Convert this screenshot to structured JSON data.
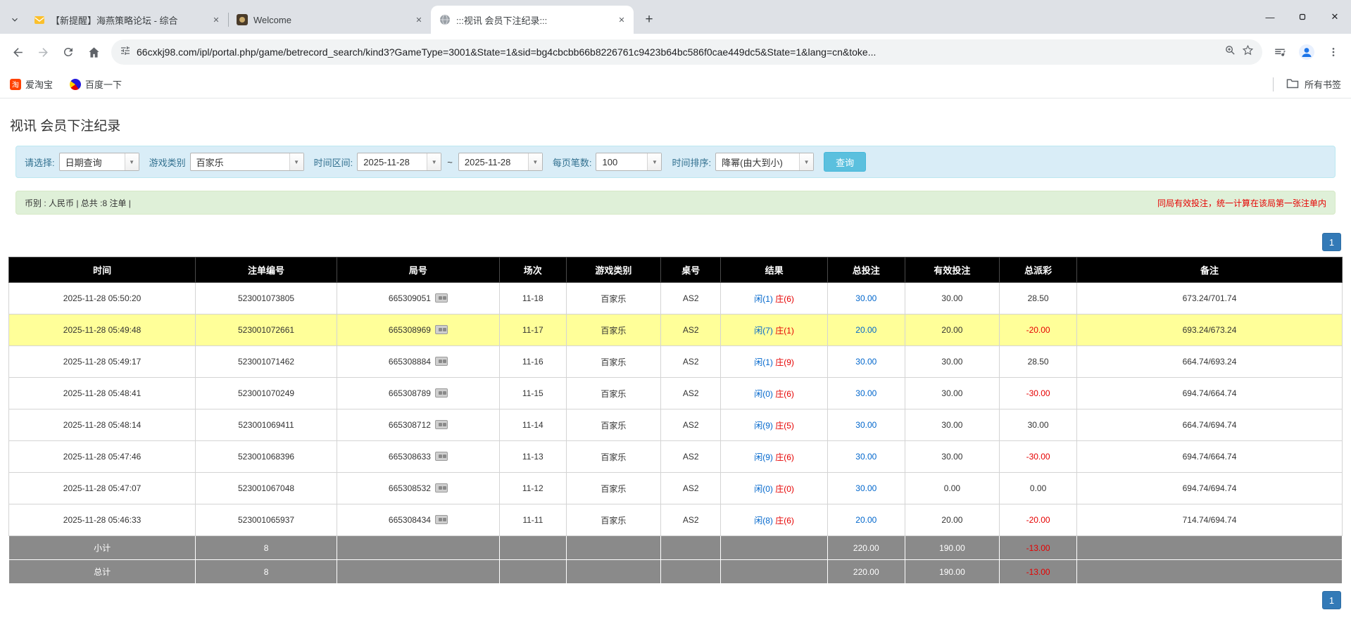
{
  "colors": {
    "accent_blue": "#337ab7",
    "link_blue": "#0066cc",
    "negative_red": "#e60000",
    "highlight_yellow": "#ffff99",
    "header_black": "#000000",
    "footer_gray": "#8a8a8a",
    "filter_bg": "#d9edf7",
    "summary_bg": "#dff0d8",
    "search_btn": "#5bc0de"
  },
  "browser": {
    "tabs": [
      {
        "title": "【新提醒】海燕策略论坛 - 综合"
      },
      {
        "title": "Welcome"
      },
      {
        "title": ":::视讯 会员下注纪录:::"
      }
    ],
    "url": "66cxkj98.com/ipl/portal.php/game/betrecord_search/kind3?GameType=3001&State=1&sid=bg4cbcbb66b8226761c9423b64bc586f0cae449dc5&State=1&lang=cn&toke...",
    "bookmarks": {
      "items": [
        {
          "label": "爱淘宝"
        },
        {
          "label": "百度一下"
        }
      ],
      "all_bookmarks": "所有书签"
    }
  },
  "page": {
    "title": "视讯 会员下注纪录",
    "filters": {
      "select_label": "请选择:",
      "select_value": "日期查询",
      "game_type_label": "游戏类别",
      "game_type_value": "百家乐",
      "date_range_label": "时间区间:",
      "date_from": "2025-11-28",
      "tilde": "~",
      "date_to": "2025-11-28",
      "page_size_label": "每页笔数:",
      "page_size_value": "100",
      "sort_label": "时间排序:",
      "sort_value": "降幂(由大到小)",
      "search_button": "查询"
    },
    "summary": {
      "left": "币别 : 人民币 | 总共 :8 注单 |",
      "right": "同局有效投注，统一计算在该局第一张注单内"
    },
    "pagination": "1",
    "table": {
      "headers": [
        "时间",
        "注单编号",
        "局号",
        "场次",
        "游戏类别",
        "桌号",
        "结果",
        "总投注",
        "有效投注",
        "总派彩",
        "备注"
      ],
      "rows": [
        {
          "time": "2025-11-28 05:50:20",
          "bet_id": "523001073805",
          "round_id": "665309051",
          "session": "11-18",
          "game": "百家乐",
          "table_no": "AS2",
          "result_player": "闲(1)",
          "result_banker": "庄(6)",
          "total_bet": "30.00",
          "valid_bet": "30.00",
          "payout": "28.50",
          "note": "673.24/701.74",
          "highlighted": false
        },
        {
          "time": "2025-11-28 05:49:48",
          "bet_id": "523001072661",
          "round_id": "665308969",
          "session": "11-17",
          "game": "百家乐",
          "table_no": "AS2",
          "result_player": "闲(7)",
          "result_banker": "庄(1)",
          "total_bet": "20.00",
          "valid_bet": "20.00",
          "payout": "-20.00",
          "note": "693.24/673.24",
          "highlighted": true
        },
        {
          "time": "2025-11-28 05:49:17",
          "bet_id": "523001071462",
          "round_id": "665308884",
          "session": "11-16",
          "game": "百家乐",
          "table_no": "AS2",
          "result_player": "闲(1)",
          "result_banker": "庄(9)",
          "total_bet": "30.00",
          "valid_bet": "30.00",
          "payout": "28.50",
          "note": "664.74/693.24",
          "highlighted": false
        },
        {
          "time": "2025-11-28 05:48:41",
          "bet_id": "523001070249",
          "round_id": "665308789",
          "session": "11-15",
          "game": "百家乐",
          "table_no": "AS2",
          "result_player": "闲(0)",
          "result_banker": "庄(6)",
          "total_bet": "30.00",
          "valid_bet": "30.00",
          "payout": "-30.00",
          "note": "694.74/664.74",
          "highlighted": false
        },
        {
          "time": "2025-11-28 05:48:14",
          "bet_id": "523001069411",
          "round_id": "665308712",
          "session": "11-14",
          "game": "百家乐",
          "table_no": "AS2",
          "result_player": "闲(9)",
          "result_banker": "庄(5)",
          "total_bet": "30.00",
          "valid_bet": "30.00",
          "payout": "30.00",
          "note": "664.74/694.74",
          "highlighted": false
        },
        {
          "time": "2025-11-28 05:47:46",
          "bet_id": "523001068396",
          "round_id": "665308633",
          "session": "11-13",
          "game": "百家乐",
          "table_no": "AS2",
          "result_player": "闲(9)",
          "result_banker": "庄(6)",
          "total_bet": "30.00",
          "valid_bet": "30.00",
          "payout": "-30.00",
          "note": "694.74/664.74",
          "highlighted": false
        },
        {
          "time": "2025-11-28 05:47:07",
          "bet_id": "523001067048",
          "round_id": "665308532",
          "session": "11-12",
          "game": "百家乐",
          "table_no": "AS2",
          "result_player": "闲(0)",
          "result_banker": "庄(0)",
          "total_bet": "30.00",
          "valid_bet": "0.00",
          "payout": "0.00",
          "note": "694.74/694.74",
          "highlighted": false
        },
        {
          "time": "2025-11-28 05:46:33",
          "bet_id": "523001065937",
          "round_id": "665308434",
          "session": "11-11",
          "game": "百家乐",
          "table_no": "AS2",
          "result_player": "闲(8)",
          "result_banker": "庄(6)",
          "total_bet": "20.00",
          "valid_bet": "20.00",
          "payout": "-20.00",
          "note": "714.74/694.74",
          "highlighted": false
        }
      ],
      "subtotal": {
        "label": "小计",
        "count": "8",
        "total_bet": "220.00",
        "valid_bet": "190.00",
        "payout": "-13.00"
      },
      "total": {
        "label": "总计",
        "count": "8",
        "total_bet": "220.00",
        "valid_bet": "190.00",
        "payout": "-13.00"
      }
    }
  }
}
